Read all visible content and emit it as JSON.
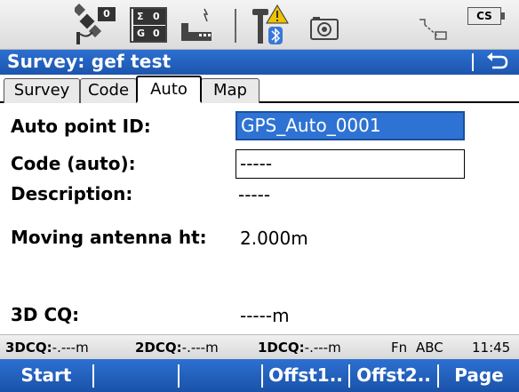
{
  "status": {
    "sat_count": "0",
    "gps_count_top": "0",
    "gps_count_bottom": "0",
    "sigma_label": "Σ",
    "g_label": "G",
    "cs_label": "CS"
  },
  "title": "Survey: gef test",
  "tabs": [
    "Survey",
    "Code",
    "Auto",
    "Map"
  ],
  "form": {
    "auto_point_id_label": "Auto point ID:",
    "auto_point_id_value": "GPS_Auto_0001",
    "code_label": "Code (auto):",
    "code_value": "-----",
    "description_label": "Description:",
    "description_value": "-----",
    "antenna_label": "Moving antenna ht:",
    "antenna_value": "2.000m",
    "cq_label": "3D CQ:",
    "cq_value": "-----m"
  },
  "info": {
    "dcq3_label": "3DCQ:",
    "dcq3_value": "-.---m",
    "dcq2_label": "2DCQ:",
    "dcq2_value": "-.---m",
    "dcq1_label": "1DCQ:",
    "dcq1_value": "-.---m",
    "fn": "Fn",
    "abc": "ABC",
    "time": "11:45"
  },
  "softkeys": [
    "Start",
    "",
    "",
    "Offst1..",
    "Offst2..",
    "Page"
  ]
}
